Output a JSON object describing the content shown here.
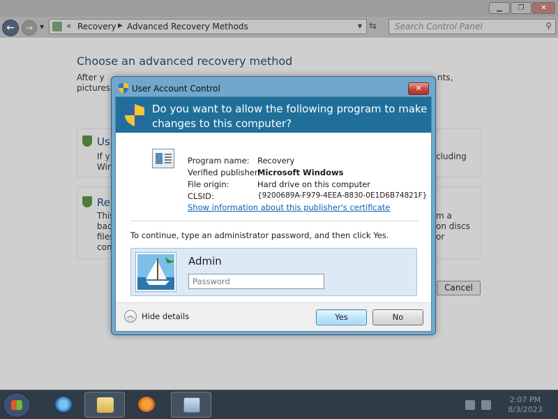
{
  "explorer": {
    "breadcrumb": [
      "Recovery",
      "Advanced Recovery Methods"
    ],
    "search_placeholder": "Search Control Panel",
    "heading": "Choose an advanced recovery method",
    "intro_line1_start": "After y",
    "intro_line1_end": "nts,",
    "intro_line2_start": "pictures,",
    "option1": {
      "title_fragment": "Us",
      "line1_start": "If y",
      "line1_end": "cluding",
      "line2_start": "Win"
    },
    "option2": {
      "title_fragment": "Re",
      "line1_start": "This",
      "line1_end": "m a",
      "line2_start": "bac",
      "line2_end": "on discs or",
      "line3_start": "files",
      "line4_start": "com"
    },
    "cancel_label": "Cancel"
  },
  "uac": {
    "title": "User Account Control",
    "close_glyph": "✕",
    "question": "Do you want to allow the following program to make changes to this computer?",
    "fields": [
      {
        "label": "Program name:",
        "value": "Recovery"
      },
      {
        "label": "Verified publisher:",
        "value": "Microsoft Windows"
      },
      {
        "label": "File origin:",
        "value": "Hard drive on this computer"
      },
      {
        "label": "CLSID:",
        "value": "{9200689A-F979-4EEA-8830-0E1D6B74821F}"
      }
    ],
    "cert_link": "Show information about this publisher's certificate",
    "instruction": "To continue, type an administrator password, and then click Yes.",
    "username": "Admin",
    "password_placeholder": "Password",
    "password_value": "",
    "details_label": "Hide details",
    "yes_label": "Yes",
    "no_label": "No"
  },
  "taskbar": {
    "time": "2:07 PM",
    "date": "8/3/2023"
  },
  "colors": {
    "uac_banner": "#1f6f9a",
    "uac_frame": "#6fa8cc",
    "link": "#0b5fb3",
    "taskbar": "#2f3b47"
  },
  "icons": [
    "back-icon",
    "forward-icon",
    "control-panel-icon",
    "refresh-icon",
    "search-icon",
    "shield-icon",
    "program-icon",
    "user-avatar",
    "chevron-up-icon",
    "start-orb",
    "ie-icon",
    "folder-icon",
    "media-player-icon",
    "network-icon",
    "volume-muted-icon"
  ]
}
